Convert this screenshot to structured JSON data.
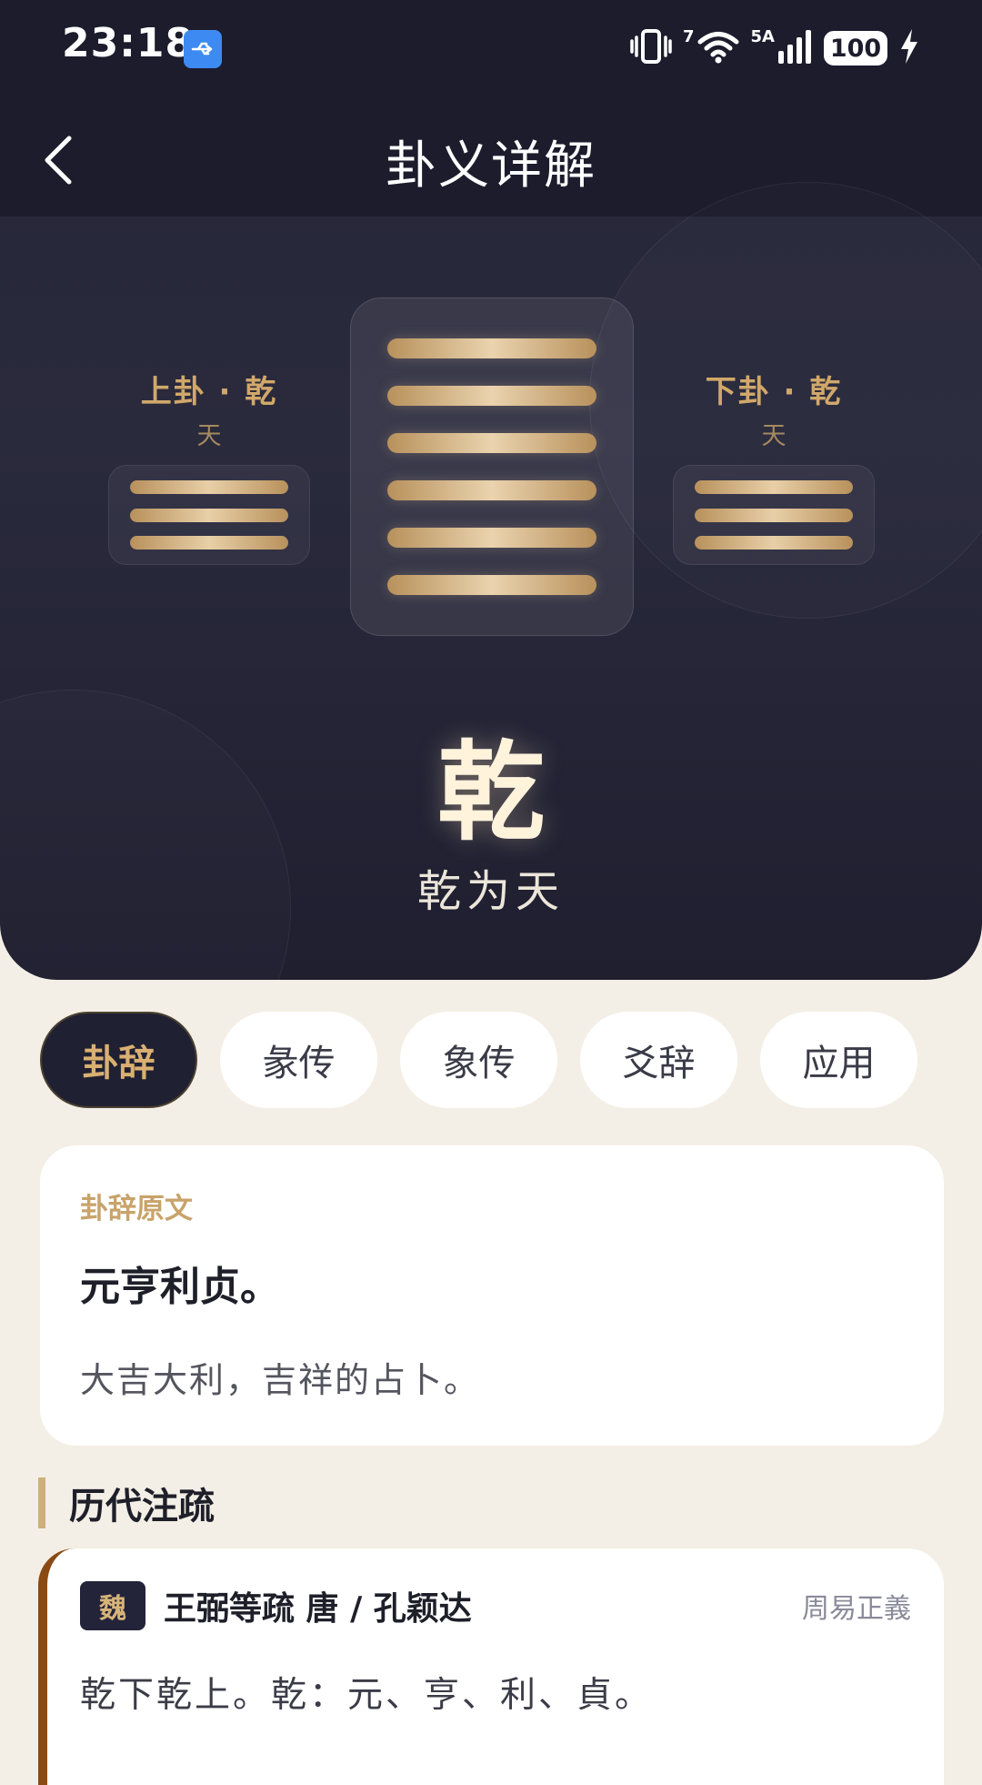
{
  "status_bar": {
    "time": "23:18",
    "network_sim1": "7",
    "network_sim2": "5A",
    "battery": "100"
  },
  "nav": {
    "title": "卦义详解"
  },
  "hexagram": {
    "upper_label": "上卦 · 乾",
    "upper_sub": "天",
    "lower_label": "下卦 · 乾",
    "lower_sub": "天",
    "name": "乾",
    "full_name": "乾为天"
  },
  "tabs": [
    {
      "label": "卦辞",
      "active": true
    },
    {
      "label": "彖传",
      "active": false
    },
    {
      "label": "象传",
      "active": false
    },
    {
      "label": "爻辞",
      "active": false
    },
    {
      "label": "应用",
      "active": false
    }
  ],
  "judgment": {
    "label": "卦辞原文",
    "original": "元亨利贞。",
    "translation": "大吉大利，吉祥的占卜。"
  },
  "commentary_section": {
    "title": "历代注疏"
  },
  "commentaries": [
    {
      "era": "魏",
      "author": "王弼等疏 唐 / 孔颖达",
      "source": "周易正義",
      "text": "乾下乾上。乾：元、亨、利、貞。"
    }
  ],
  "colors": {
    "hero_bg": "#262638",
    "accent_gold": "#d1a86a",
    "page_bg": "#f4efe6",
    "active_tab_bg": "#202033"
  }
}
